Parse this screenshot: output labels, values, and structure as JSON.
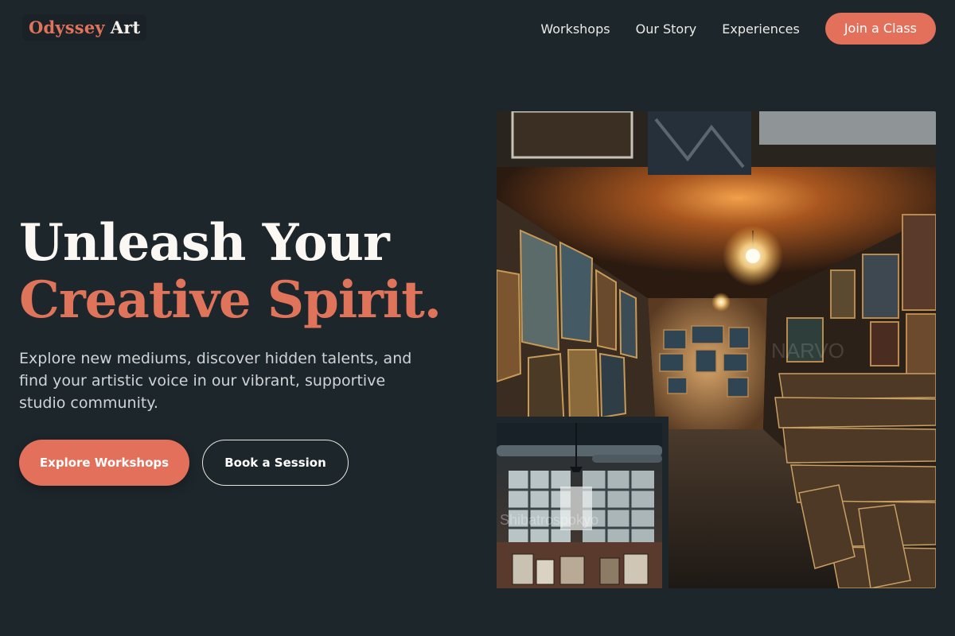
{
  "brand": {
    "name_part1": "Odyssey",
    "name_part2": "Art"
  },
  "nav": {
    "items": [
      {
        "label": "Workshops"
      },
      {
        "label": "Our Story"
      },
      {
        "label": "Experiences"
      }
    ],
    "cta_label": "Join a Class"
  },
  "hero": {
    "title_line1": "Unleash Your",
    "title_line2": "Creative Spirit.",
    "subtitle": "Explore new mediums, discover hidden talents, and find your artistic voice in our vibrant, supportive studio community.",
    "primary_button": "Explore Workshops",
    "secondary_button": "Book a Session"
  },
  "images": {
    "main_watermark": "NARVO",
    "inset_watermark": "Shibatrospokyo"
  },
  "colors": {
    "background": "#1d262b",
    "accent": "#e2705a",
    "text_light": "#fbf7f2",
    "text_muted": "#d0d4d6"
  }
}
